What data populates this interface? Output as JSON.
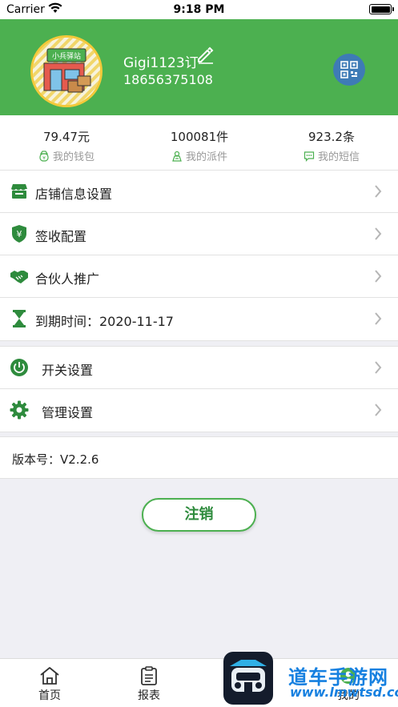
{
  "status_bar": {
    "carrier": "Carrier",
    "time": "9:18 PM"
  },
  "profile": {
    "shop_sign": "小兵驿站",
    "name": "Gigi1123订",
    "phone": "18656375108"
  },
  "stats": [
    {
      "value": "79.47元",
      "label": "我的钱包",
      "icon": "wallet-icon"
    },
    {
      "value": "100081件",
      "label": "我的派件",
      "icon": "courier-icon"
    },
    {
      "value": "923.2条",
      "label": "我的短信",
      "icon": "message-icon"
    }
  ],
  "menu_group_1": [
    {
      "label": "店铺信息设置",
      "icon": "store-icon"
    },
    {
      "label": "签收配置",
      "icon": "shield-yen-icon"
    },
    {
      "label": "合伙人推广",
      "icon": "handshake-icon"
    },
    {
      "label": "到期时间：2020-11-17",
      "icon": "hourglass-icon"
    }
  ],
  "menu_group_2": [
    {
      "label": "开关设置",
      "icon": "power-icon"
    },
    {
      "label": "管理设置",
      "icon": "gear-icon"
    }
  ],
  "version": "版本号：V2.2.6",
  "logout_label": "注销",
  "tabs": [
    {
      "label": "首页",
      "icon": "home-icon"
    },
    {
      "label": "报表",
      "icon": "report-icon"
    },
    {
      "label": "",
      "icon": ""
    },
    {
      "label": "我的",
      "icon": "profile-icon"
    }
  ],
  "watermark": {
    "text": "道车手游网",
    "url_text": "www.lmwtsd.com"
  },
  "colors": {
    "brand_green": "#4cb050",
    "qr_blue": "#3e7bb6",
    "icon_green": "#2e8b3d"
  }
}
